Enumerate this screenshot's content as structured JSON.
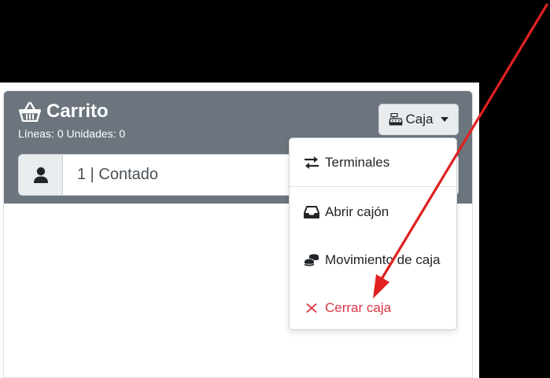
{
  "cart": {
    "title": "Carrito",
    "summary": "Líneas: 0 Unidades: 0",
    "customer": "1 | Contado"
  },
  "caja_button": {
    "label": "Caja"
  },
  "menu": {
    "items": [
      {
        "label": "Terminales",
        "icon": "exchange-icon"
      },
      {
        "label": "Abrir cajón",
        "icon": "inbox-icon"
      },
      {
        "label": "Movimiento de caja",
        "icon": "coins-icon"
      },
      {
        "label": "Cerrar caja",
        "icon": "close-icon"
      }
    ]
  },
  "colors": {
    "header_bg": "#6c757d",
    "danger": "#dc3545",
    "arrow": "#e02020"
  }
}
